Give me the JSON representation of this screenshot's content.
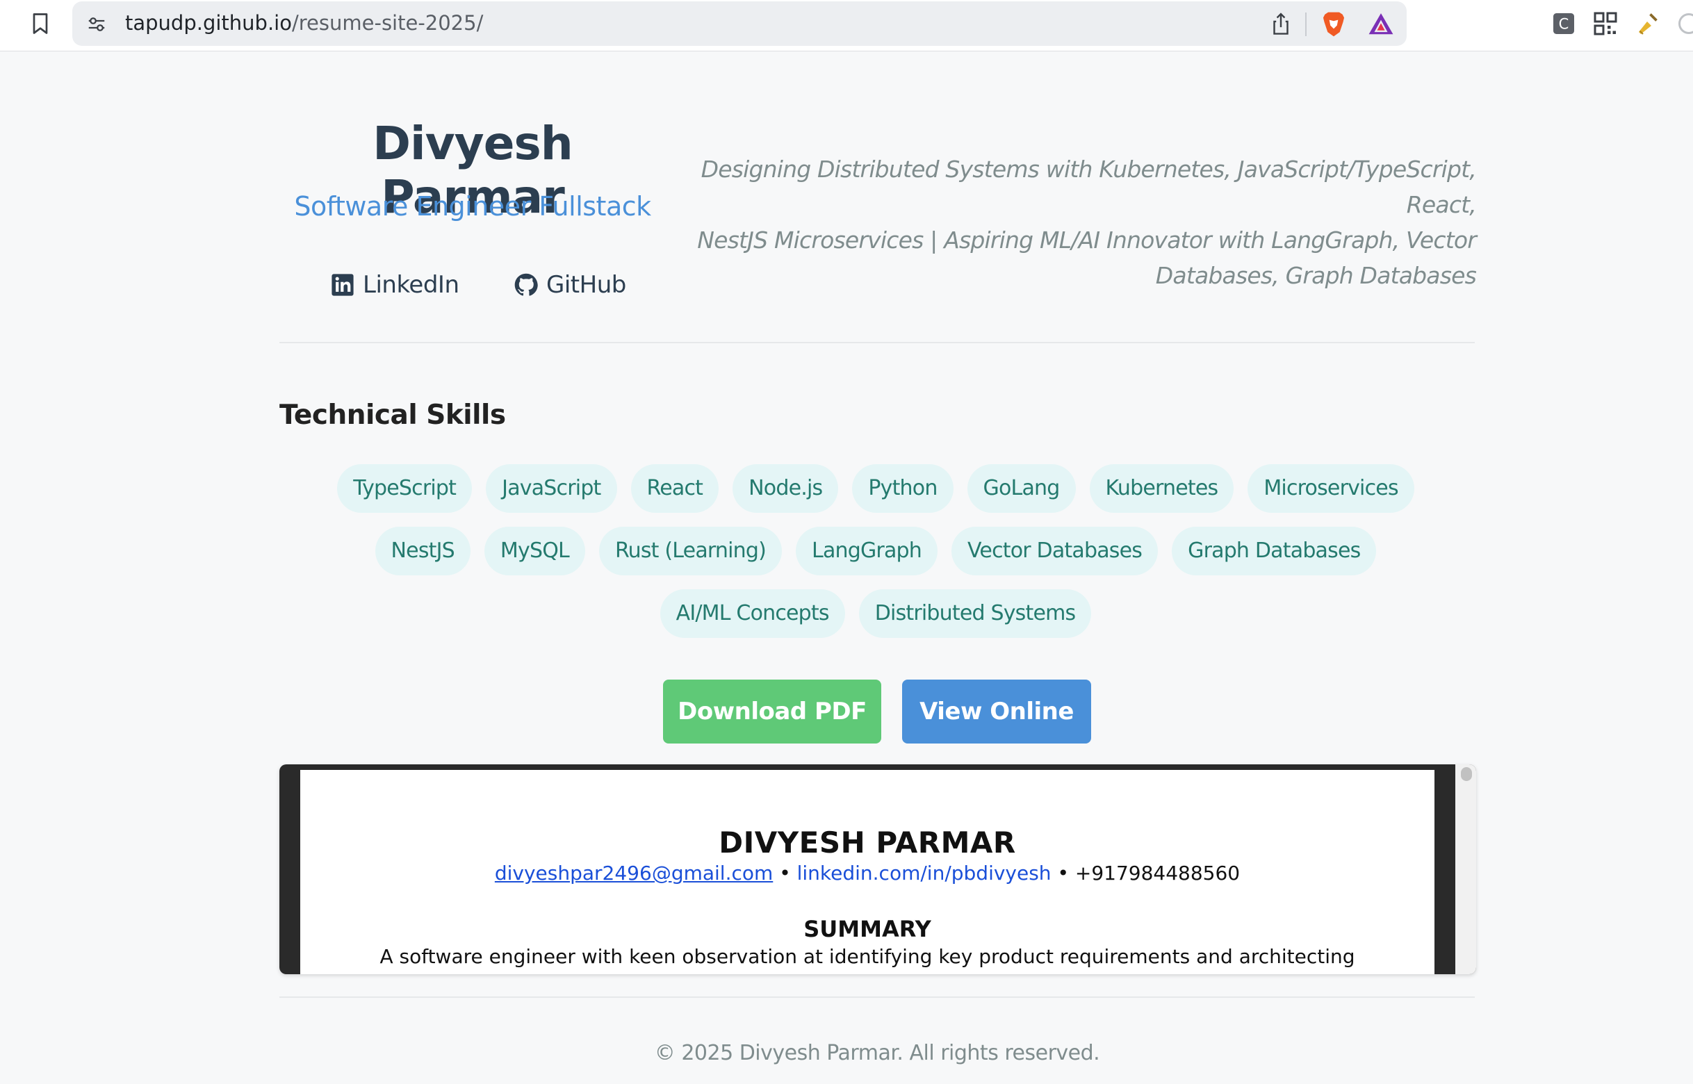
{
  "browser": {
    "url_host": "tapudp.github.io",
    "url_path": "/resume-site-2025/",
    "icons": [
      "bookmark-icon",
      "site-settings-icon",
      "share-icon",
      "brave-shield-icon",
      "brave-rewards-icon",
      "extension-c-icon",
      "qr-code-icon",
      "broom-icon"
    ]
  },
  "header": {
    "name": "Divyesh Parmar",
    "role": "Software Engineer Fullstack",
    "tagline_lines": [
      "Designing Distributed Systems with Kubernetes, JavaScript/TypeScript, React,",
      "NestJS Microservices | Aspiring ML/AI Innovator with LangGraph, Vector",
      "Databases, Graph Databases"
    ],
    "links": [
      {
        "label": "LinkedIn",
        "icon": "linkedin-icon"
      },
      {
        "label": "GitHub",
        "icon": "github-icon"
      }
    ]
  },
  "skills": {
    "title": "Technical Skills",
    "items": [
      "TypeScript",
      "JavaScript",
      "React",
      "Node.js",
      "Python",
      "GoLang",
      "Kubernetes",
      "Microservices",
      "NestJS",
      "MySQL",
      "Rust (Learning)",
      "LangGraph",
      "Vector Databases",
      "Graph Databases",
      "AI/ML Concepts",
      "Distributed Systems"
    ]
  },
  "actions": {
    "download_label": "Download PDF",
    "view_label": "View Online"
  },
  "pdf_preview": {
    "name": "DIVYESH PARMAR",
    "email": "divyeshpar2496@gmail.com",
    "linkedin": "linkedin.com/in/pbdivyesh",
    "phone": "+917984488560",
    "summary_heading": "SUMMARY",
    "summary_text": "A software engineer with keen observation at identifying key product requirements and architecting"
  },
  "footer": {
    "text": "© 2025 Divyesh Parmar. All rights reserved."
  },
  "colors": {
    "name": "#2c3e50",
    "accent_blue": "#4a90d9",
    "download_green": "#5fc977",
    "skill_bg": "#e4f5f6",
    "skill_text": "#247a6e",
    "muted": "#7f8c8d"
  }
}
